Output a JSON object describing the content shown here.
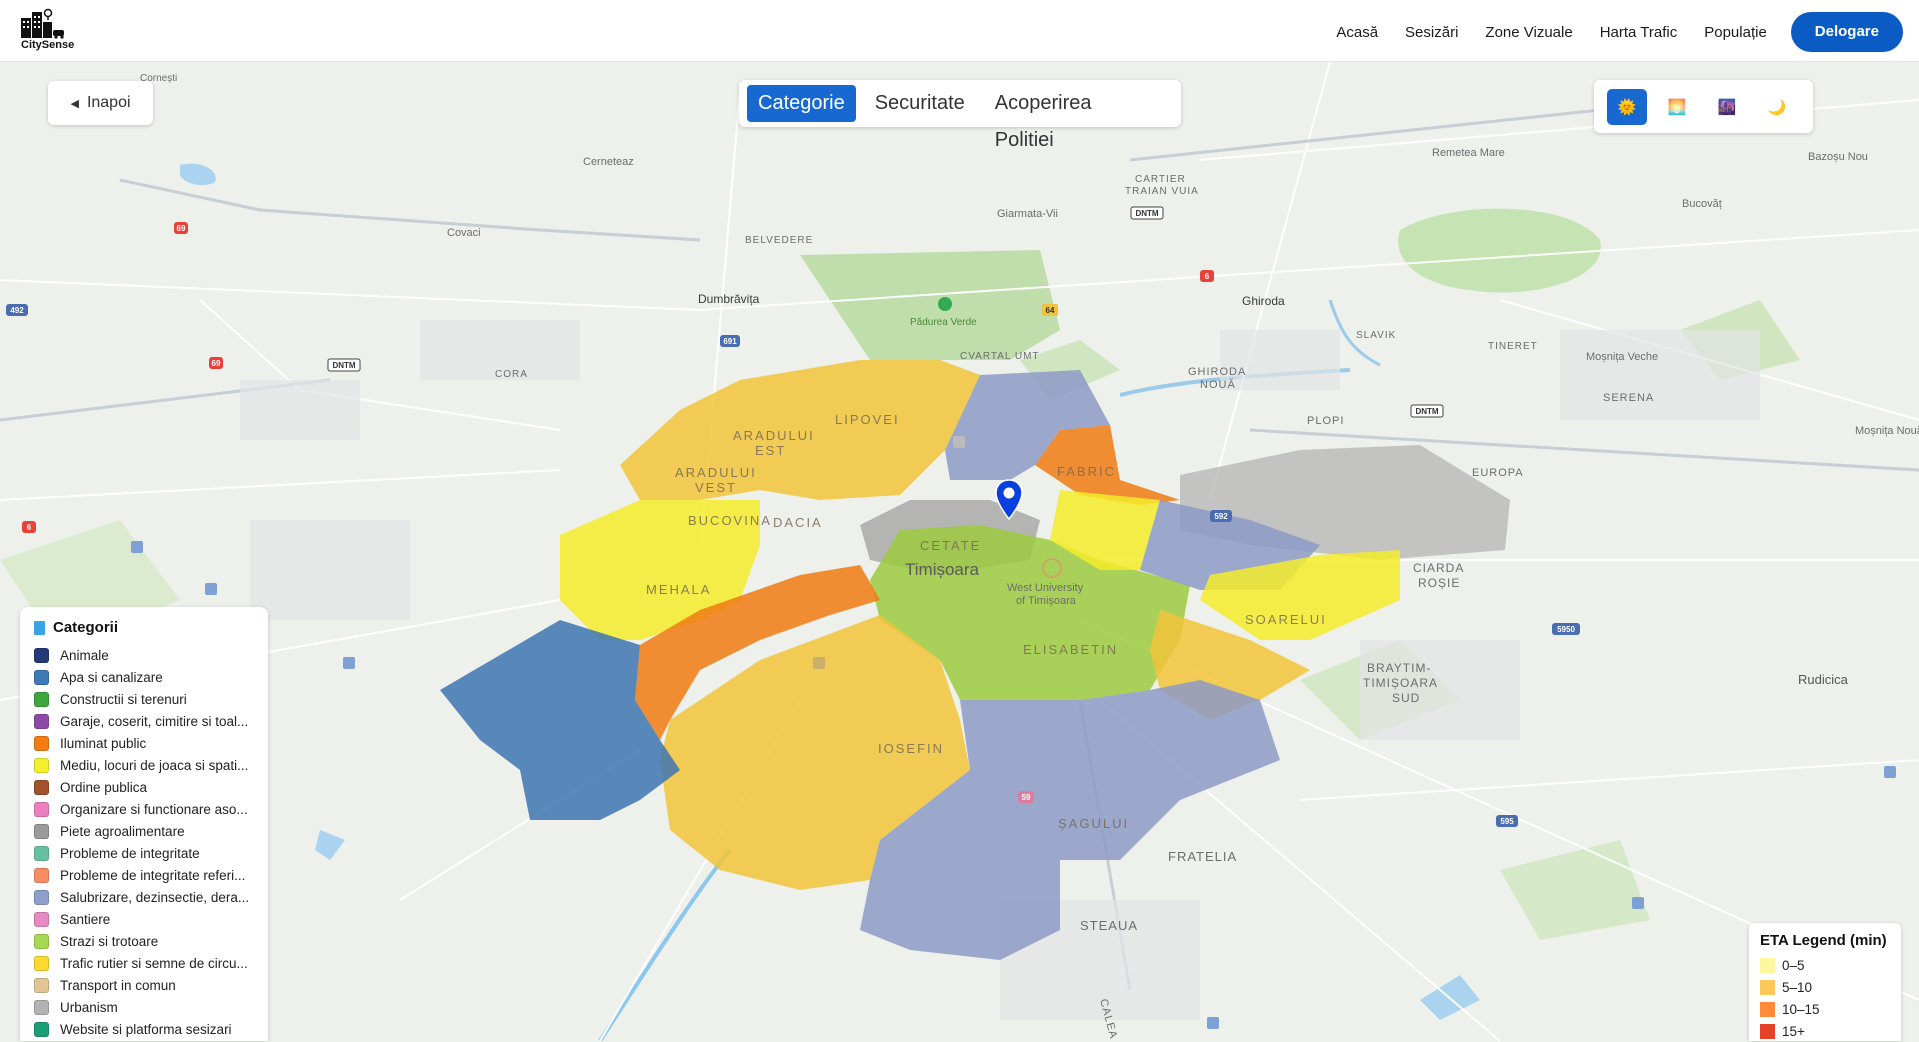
{
  "header": {
    "logo_text": "CitySense",
    "nav": [
      {
        "label": "Acasă"
      },
      {
        "label": "Sesizări"
      },
      {
        "label": "Zone Vizuale"
      },
      {
        "label": "Harta Trafic"
      },
      {
        "label": "Populație"
      }
    ],
    "cta": "Delogare"
  },
  "back_button": "Inapoi",
  "tabs": [
    {
      "label": "Categorie",
      "active": true
    },
    {
      "label": "Securitate",
      "active": false
    },
    {
      "label": "Acoperirea Politiei",
      "active": false
    }
  ],
  "theme_buttons": [
    {
      "icon": "sun-icon",
      "active": true
    },
    {
      "icon": "sunrise-icon",
      "active": false
    },
    {
      "icon": "city-dusk-icon",
      "active": false
    },
    {
      "icon": "moon-icon",
      "active": false
    }
  ],
  "categories": {
    "title": "Categorii",
    "items": [
      {
        "label": "Animale",
        "color": "#243a78"
      },
      {
        "label": "Apa si canalizare",
        "color": "#3c7ab8"
      },
      {
        "label": "Constructii si terenuri",
        "color": "#3fa63f"
      },
      {
        "label": "Garaje, coserit, cimitire si toal...",
        "color": "#8e48a8"
      },
      {
        "label": "Iluminat public",
        "color": "#f47c12"
      },
      {
        "label": "Mediu, locuri de joaca si spati...",
        "color": "#f4ee2c"
      },
      {
        "label": "Ordine publica",
        "color": "#a1522a"
      },
      {
        "label": "Organizare si functionare aso...",
        "color": "#ec7fc0"
      },
      {
        "label": "Piete agroalimentare",
        "color": "#9b9b9b"
      },
      {
        "label": "Probleme de integritate",
        "color": "#66c1a2"
      },
      {
        "label": "Probleme de integritate referi...",
        "color": "#f98c62"
      },
      {
        "label": "Salubrizare, dezinsectie, dera...",
        "color": "#8d9fcb"
      },
      {
        "label": "Santiere",
        "color": "#e78ac3"
      },
      {
        "label": "Strazi si trotoare",
        "color": "#a6d854"
      },
      {
        "label": "Trafic rutier si semne de circu...",
        "color": "#ffd92f"
      },
      {
        "label": "Transport in comun",
        "color": "#e4c494"
      },
      {
        "label": "Urbanism",
        "color": "#b3b3b3"
      },
      {
        "label": "Website si platforma sesizari",
        "color": "#1b9e77"
      }
    ]
  },
  "eta_legend": {
    "title": "ETA Legend (min)",
    "items": [
      {
        "label": "0–5",
        "color": "#fff6a0"
      },
      {
        "label": "5–10",
        "color": "#ffc95a"
      },
      {
        "label": "10–15",
        "color": "#ff8a3a"
      },
      {
        "label": "15+",
        "color": "#e8412a"
      }
    ]
  },
  "map": {
    "place_labels": [
      "Cornești",
      "Cerneteaz",
      "Covaci",
      "BELVEDERE",
      "Giarmata-Vii",
      "CARTIER",
      "TRAIAN VUIA",
      "Remetea Mare",
      "Bazoșu Nou",
      "Bucovăț",
      "Dumbrăvița",
      "Pădurea Verde",
      "CVARTAL UMT",
      "Ghiroda",
      "SLAVIK",
      "GHIRODA",
      "NOUĂ",
      "TINERET",
      "Moșnița Veche",
      "SERENA",
      "Moșnița Nouă",
      "CORA",
      "PLOPI",
      "EUROPA",
      "ARADULUI",
      "EST",
      "LIPOVEI",
      "ARADULUI",
      "VEST",
      "FABRIC",
      "BUCOVINA",
      "DACIA",
      "CETATE",
      "Timișoara",
      "West University",
      "of Timișoara",
      "MEHALA",
      "ELISABETIN",
      "SOARELUI",
      "CIARDA",
      "ROȘIE",
      "BRAYTIM-",
      "TIMIȘOARA",
      "SUD",
      "Rudicica",
      "IOSEFIN",
      "ȘAGULUI",
      "FRATELIA",
      "STEAUA",
      "CALEA"
    ],
    "road_shields": [
      "69",
      "492",
      "69",
      "DNTM",
      "691",
      "64",
      "DNTM",
      "6",
      "DNTM",
      "6",
      "592",
      "5950",
      "595",
      "59"
    ]
  }
}
